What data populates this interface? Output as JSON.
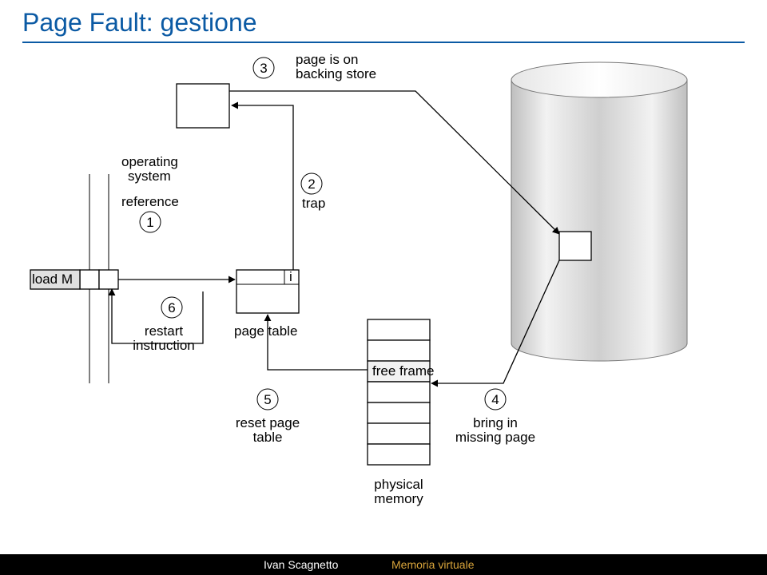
{
  "title": "Page Fault: gestione",
  "footer": {
    "author": "Ivan Scagnetto",
    "topic": "Memoria virtuale"
  },
  "steps": {
    "s1": "1",
    "s2": "2",
    "s3": "3",
    "s4": "4",
    "s5": "5",
    "s6": "6"
  },
  "labels": {
    "os": "operating\nsystem",
    "reference": "reference",
    "trap": "trap",
    "loadM": "load M",
    "restart": "restart\ninstruction",
    "pagetable": "page table",
    "reset": "reset page\ntable",
    "ibit": "i",
    "freeframe": "free frame",
    "bringin": "bring in\nmissing page",
    "backing": "page is on\nbacking store",
    "physmem": "physical\nmemory"
  }
}
